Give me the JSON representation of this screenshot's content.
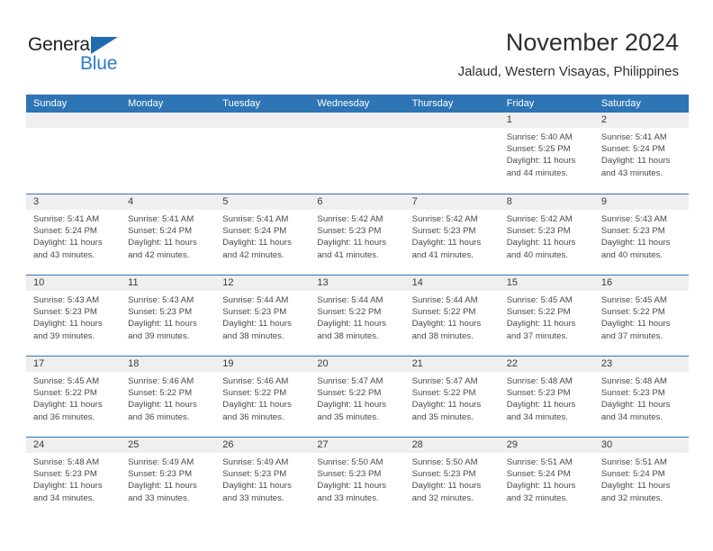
{
  "logo": {
    "word1": "General",
    "word2": "Blue",
    "triangle_color": "#1f6cb0",
    "word2_color": "#2b7cc4"
  },
  "header": {
    "title": "November 2024",
    "subtitle": "Jalaud, Western Visayas, Philippines"
  },
  "theme": {
    "header_blue": "#2e75b6",
    "day_band_gray": "#efefef",
    "text_color": "#4a4a4a"
  },
  "calendar": {
    "day_names": [
      "Sunday",
      "Monday",
      "Tuesday",
      "Wednesday",
      "Thursday",
      "Friday",
      "Saturday"
    ],
    "weeks": [
      [
        {
          "empty": true
        },
        {
          "empty": true
        },
        {
          "empty": true
        },
        {
          "empty": true
        },
        {
          "empty": true
        },
        {
          "day": "1",
          "sunrise": "Sunrise: 5:40 AM",
          "sunset": "Sunset: 5:25 PM",
          "daylight": "Daylight: 11 hours and 44 minutes."
        },
        {
          "day": "2",
          "sunrise": "Sunrise: 5:41 AM",
          "sunset": "Sunset: 5:24 PM",
          "daylight": "Daylight: 11 hours and 43 minutes."
        }
      ],
      [
        {
          "day": "3",
          "sunrise": "Sunrise: 5:41 AM",
          "sunset": "Sunset: 5:24 PM",
          "daylight": "Daylight: 11 hours and 43 minutes."
        },
        {
          "day": "4",
          "sunrise": "Sunrise: 5:41 AM",
          "sunset": "Sunset: 5:24 PM",
          "daylight": "Daylight: 11 hours and 42 minutes."
        },
        {
          "day": "5",
          "sunrise": "Sunrise: 5:41 AM",
          "sunset": "Sunset: 5:24 PM",
          "daylight": "Daylight: 11 hours and 42 minutes."
        },
        {
          "day": "6",
          "sunrise": "Sunrise: 5:42 AM",
          "sunset": "Sunset: 5:23 PM",
          "daylight": "Daylight: 11 hours and 41 minutes."
        },
        {
          "day": "7",
          "sunrise": "Sunrise: 5:42 AM",
          "sunset": "Sunset: 5:23 PM",
          "daylight": "Daylight: 11 hours and 41 minutes."
        },
        {
          "day": "8",
          "sunrise": "Sunrise: 5:42 AM",
          "sunset": "Sunset: 5:23 PM",
          "daylight": "Daylight: 11 hours and 40 minutes."
        },
        {
          "day": "9",
          "sunrise": "Sunrise: 5:43 AM",
          "sunset": "Sunset: 5:23 PM",
          "daylight": "Daylight: 11 hours and 40 minutes."
        }
      ],
      [
        {
          "day": "10",
          "sunrise": "Sunrise: 5:43 AM",
          "sunset": "Sunset: 5:23 PM",
          "daylight": "Daylight: 11 hours and 39 minutes."
        },
        {
          "day": "11",
          "sunrise": "Sunrise: 5:43 AM",
          "sunset": "Sunset: 5:23 PM",
          "daylight": "Daylight: 11 hours and 39 minutes."
        },
        {
          "day": "12",
          "sunrise": "Sunrise: 5:44 AM",
          "sunset": "Sunset: 5:23 PM",
          "daylight": "Daylight: 11 hours and 38 minutes."
        },
        {
          "day": "13",
          "sunrise": "Sunrise: 5:44 AM",
          "sunset": "Sunset: 5:22 PM",
          "daylight": "Daylight: 11 hours and 38 minutes."
        },
        {
          "day": "14",
          "sunrise": "Sunrise: 5:44 AM",
          "sunset": "Sunset: 5:22 PM",
          "daylight": "Daylight: 11 hours and 38 minutes."
        },
        {
          "day": "15",
          "sunrise": "Sunrise: 5:45 AM",
          "sunset": "Sunset: 5:22 PM",
          "daylight": "Daylight: 11 hours and 37 minutes."
        },
        {
          "day": "16",
          "sunrise": "Sunrise: 5:45 AM",
          "sunset": "Sunset: 5:22 PM",
          "daylight": "Daylight: 11 hours and 37 minutes."
        }
      ],
      [
        {
          "day": "17",
          "sunrise": "Sunrise: 5:45 AM",
          "sunset": "Sunset: 5:22 PM",
          "daylight": "Daylight: 11 hours and 36 minutes."
        },
        {
          "day": "18",
          "sunrise": "Sunrise: 5:46 AM",
          "sunset": "Sunset: 5:22 PM",
          "daylight": "Daylight: 11 hours and 36 minutes."
        },
        {
          "day": "19",
          "sunrise": "Sunrise: 5:46 AM",
          "sunset": "Sunset: 5:22 PM",
          "daylight": "Daylight: 11 hours and 36 minutes."
        },
        {
          "day": "20",
          "sunrise": "Sunrise: 5:47 AM",
          "sunset": "Sunset: 5:22 PM",
          "daylight": "Daylight: 11 hours and 35 minutes."
        },
        {
          "day": "21",
          "sunrise": "Sunrise: 5:47 AM",
          "sunset": "Sunset: 5:22 PM",
          "daylight": "Daylight: 11 hours and 35 minutes."
        },
        {
          "day": "22",
          "sunrise": "Sunrise: 5:48 AM",
          "sunset": "Sunset: 5:23 PM",
          "daylight": "Daylight: 11 hours and 34 minutes."
        },
        {
          "day": "23",
          "sunrise": "Sunrise: 5:48 AM",
          "sunset": "Sunset: 5:23 PM",
          "daylight": "Daylight: 11 hours and 34 minutes."
        }
      ],
      [
        {
          "day": "24",
          "sunrise": "Sunrise: 5:48 AM",
          "sunset": "Sunset: 5:23 PM",
          "daylight": "Daylight: 11 hours and 34 minutes."
        },
        {
          "day": "25",
          "sunrise": "Sunrise: 5:49 AM",
          "sunset": "Sunset: 5:23 PM",
          "daylight": "Daylight: 11 hours and 33 minutes."
        },
        {
          "day": "26",
          "sunrise": "Sunrise: 5:49 AM",
          "sunset": "Sunset: 5:23 PM",
          "daylight": "Daylight: 11 hours and 33 minutes."
        },
        {
          "day": "27",
          "sunrise": "Sunrise: 5:50 AM",
          "sunset": "Sunset: 5:23 PM",
          "daylight": "Daylight: 11 hours and 33 minutes."
        },
        {
          "day": "28",
          "sunrise": "Sunrise: 5:50 AM",
          "sunset": "Sunset: 5:23 PM",
          "daylight": "Daylight: 11 hours and 32 minutes."
        },
        {
          "day": "29",
          "sunrise": "Sunrise: 5:51 AM",
          "sunset": "Sunset: 5:24 PM",
          "daylight": "Daylight: 11 hours and 32 minutes."
        },
        {
          "day": "30",
          "sunrise": "Sunrise: 5:51 AM",
          "sunset": "Sunset: 5:24 PM",
          "daylight": "Daylight: 11 hours and 32 minutes."
        }
      ]
    ]
  }
}
